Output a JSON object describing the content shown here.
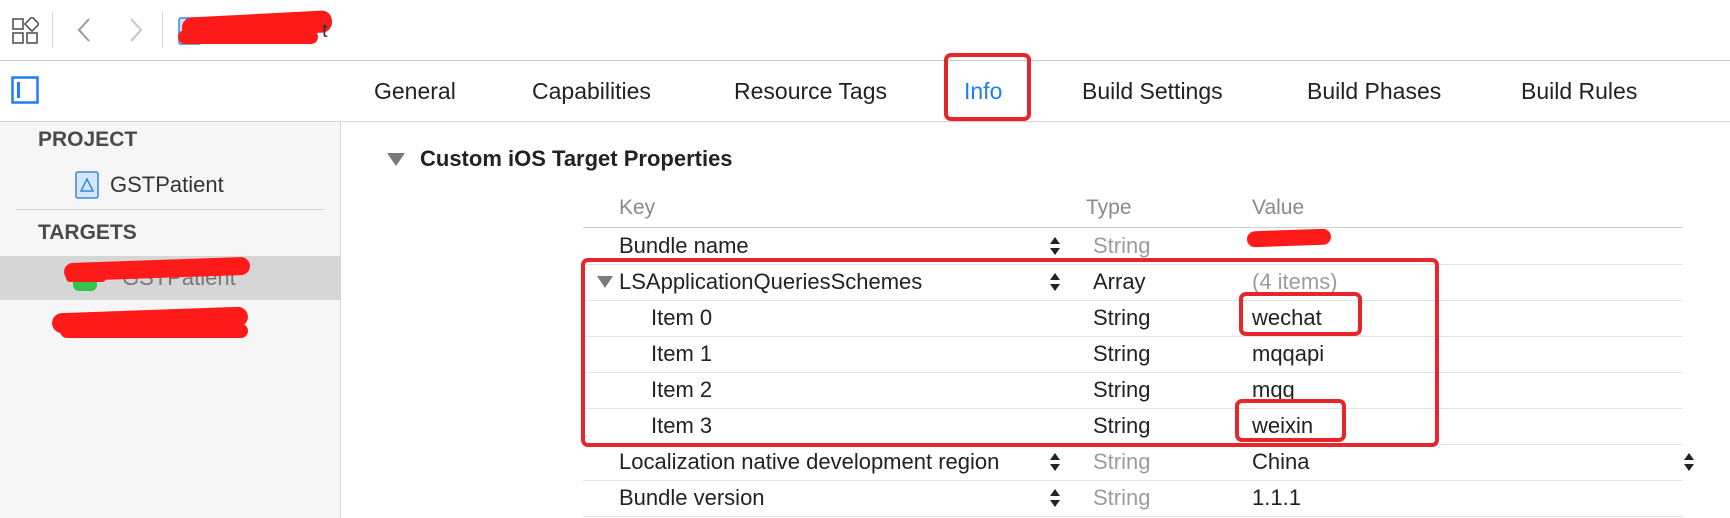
{
  "toolbar": {
    "crumb_tail": "t"
  },
  "tabs": [
    {
      "label": "General",
      "active": false
    },
    {
      "label": "Capabilities",
      "active": false
    },
    {
      "label": "Resource Tags",
      "active": false
    },
    {
      "label": "Info",
      "active": true
    },
    {
      "label": "Build Settings",
      "active": false
    },
    {
      "label": "Build Phases",
      "active": false
    },
    {
      "label": "Build Rules",
      "active": false
    }
  ],
  "sidebar": {
    "project_header": "PROJECT",
    "project_item": "GSTPatient",
    "targets_header": "TARGETS",
    "target_item": "GSTPatient"
  },
  "main": {
    "section_title": "Custom iOS Target Properties",
    "columns": {
      "key": "Key",
      "type": "Type",
      "value": "Value"
    },
    "rows": [
      {
        "key": "Bundle name",
        "type": "String",
        "value": "",
        "type_muted": true,
        "value_muted": false
      },
      {
        "key": "LSApplicationQueriesSchemes",
        "type": "Array",
        "value": "(4 items)",
        "type_muted": false,
        "value_muted": true
      },
      {
        "key": "Item 0",
        "type": "String",
        "value": "wechat",
        "type_muted": false,
        "value_muted": false
      },
      {
        "key": "Item 1",
        "type": "String",
        "value": "mqqapi",
        "type_muted": false,
        "value_muted": false
      },
      {
        "key": "Item 2",
        "type": "String",
        "value": "mqq",
        "type_muted": false,
        "value_muted": false
      },
      {
        "key": "Item 3",
        "type": "String",
        "value": "weixin",
        "type_muted": false,
        "value_muted": false
      },
      {
        "key": "Localization native development region",
        "type": "String",
        "value": "China",
        "type_muted": true,
        "value_muted": false
      },
      {
        "key": "Bundle version",
        "type": "String",
        "value": "1.1.1",
        "type_muted": true,
        "value_muted": false
      }
    ]
  },
  "colors": {
    "accent": "#1d7ff0",
    "highlight": "#e8252b",
    "redaction": "#ff1a1a"
  }
}
